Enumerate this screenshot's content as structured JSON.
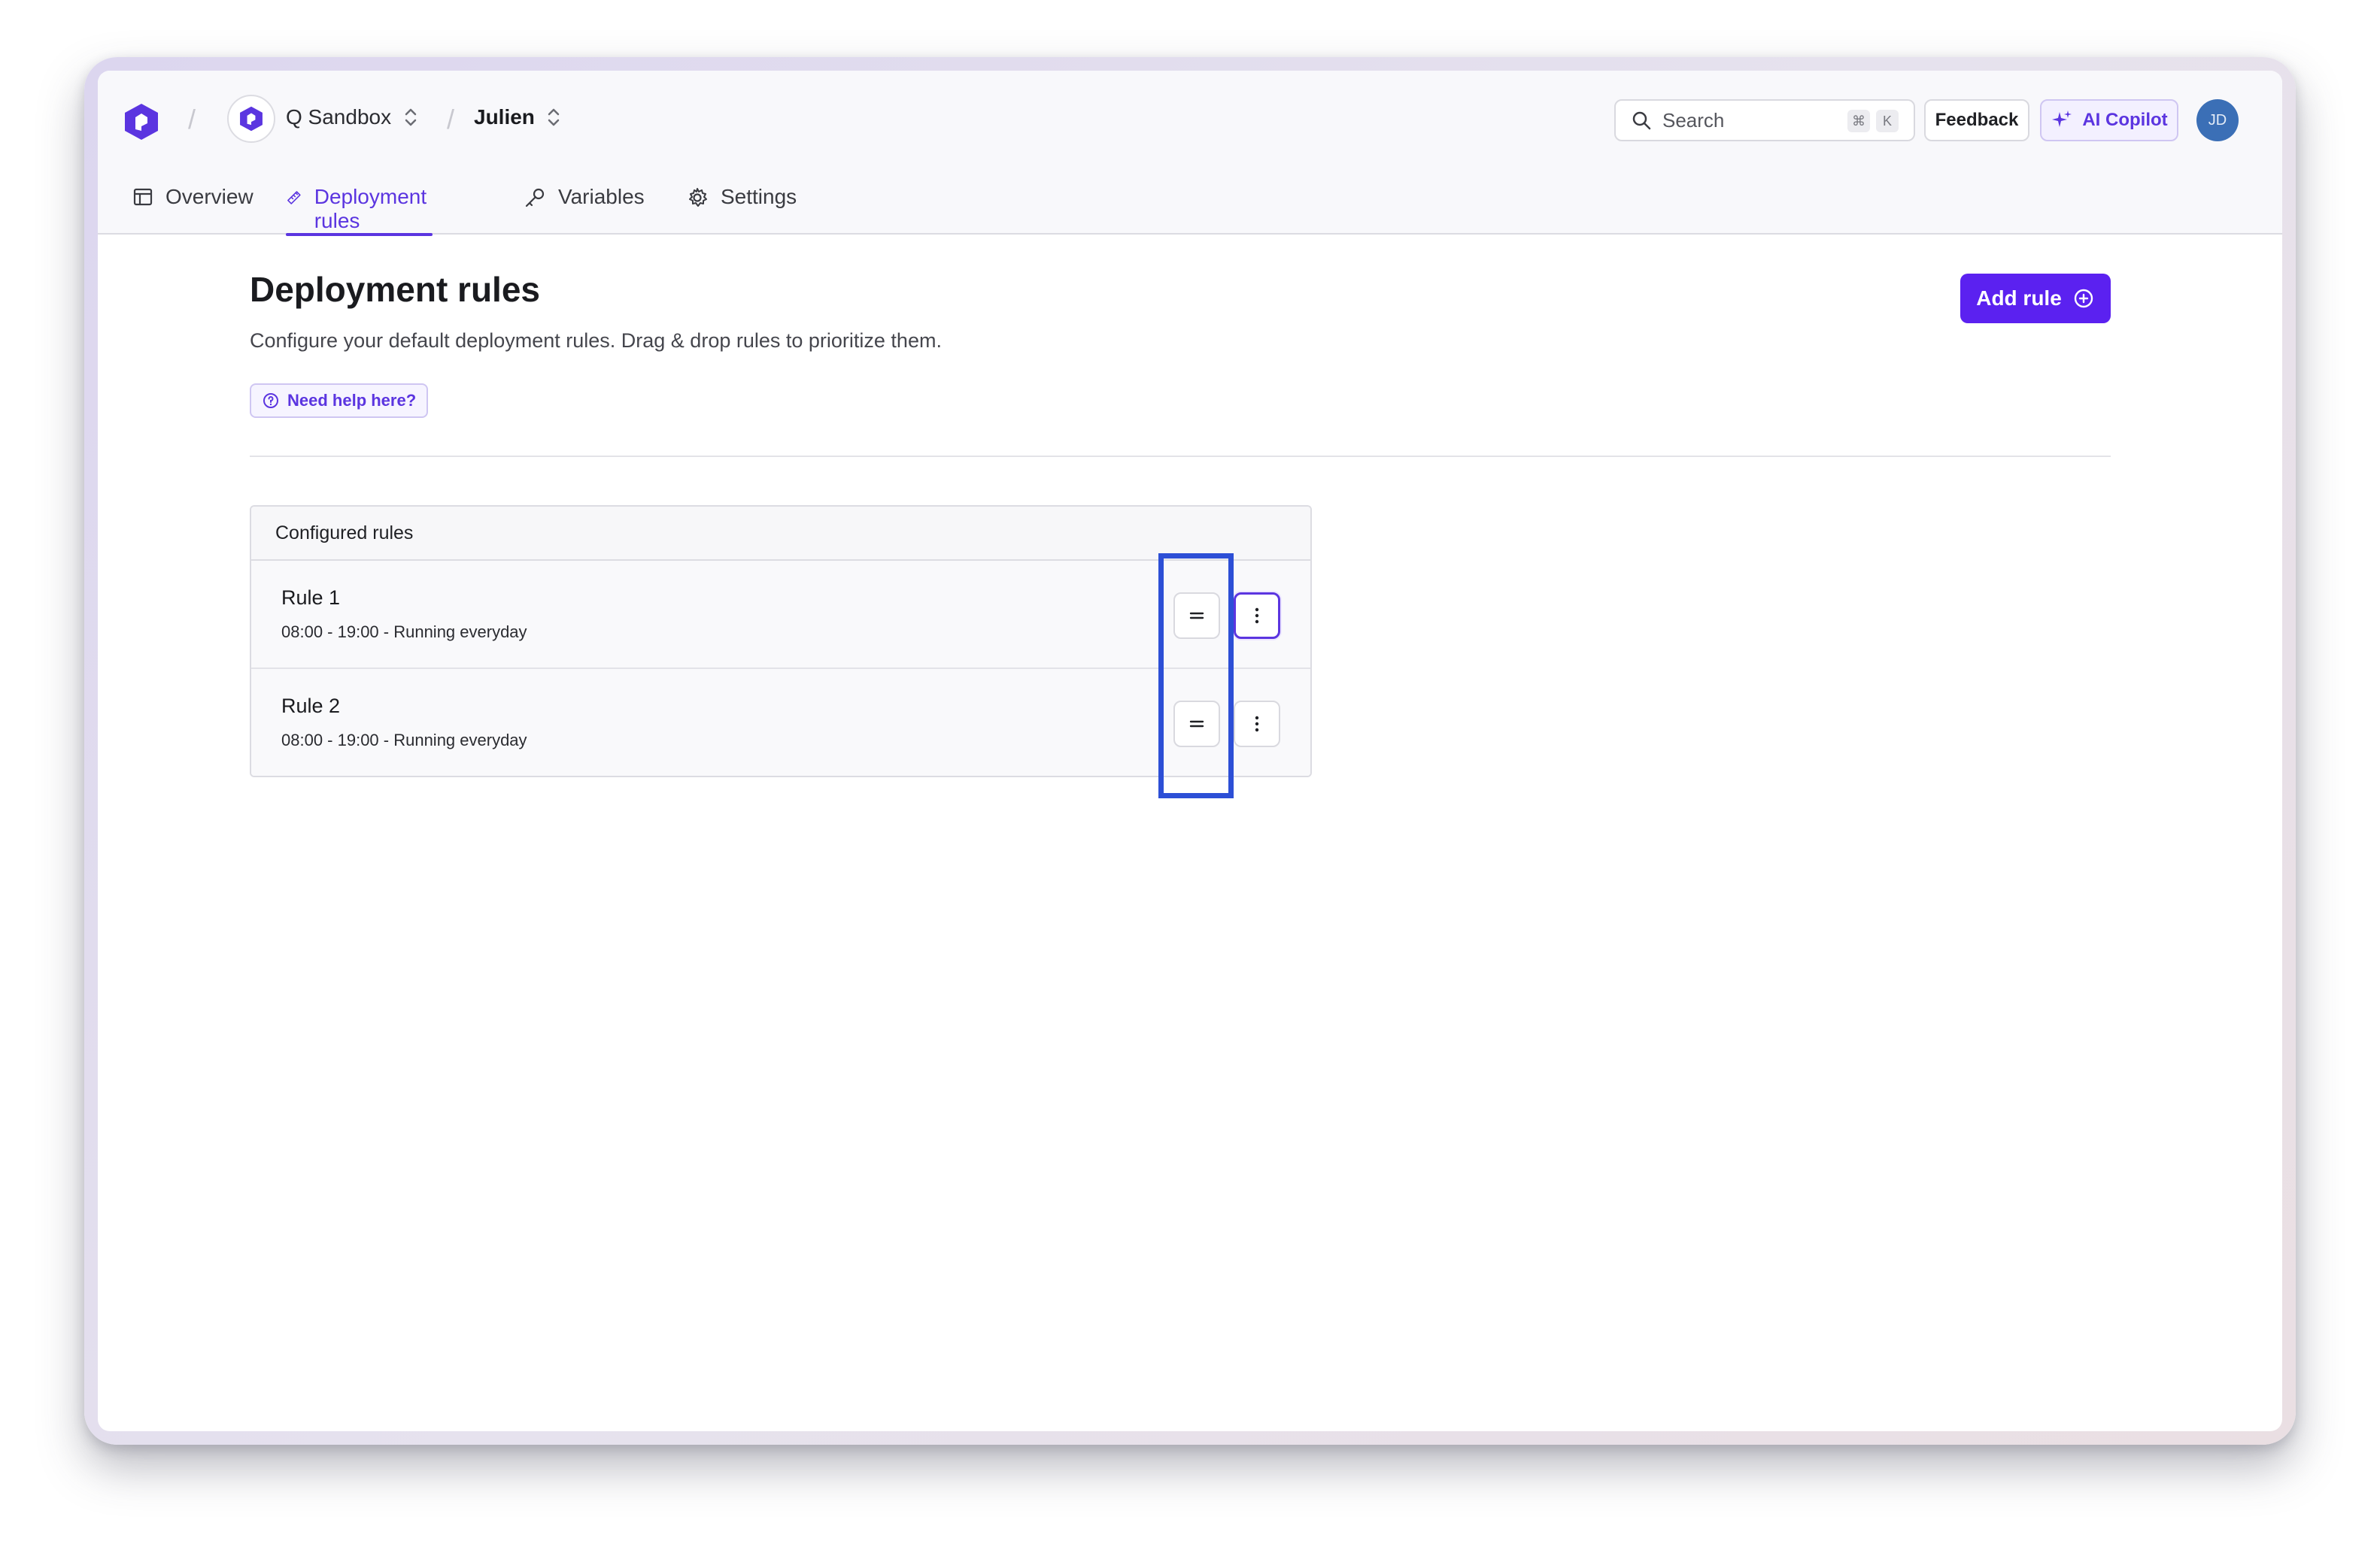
{
  "header": {
    "org_name": "Q Sandbox",
    "project_name": "Julien",
    "search_placeholder": "Search",
    "search_shortcut_mod": "⌘",
    "search_shortcut_key": "K",
    "feedback_label": "Feedback",
    "copilot_label": "AI Copilot",
    "user_initials": "JD"
  },
  "tabs": [
    {
      "label": "Overview",
      "icon": "layout-icon",
      "active": false
    },
    {
      "label": "Deployment rules",
      "icon": "ruler-icon",
      "active": true
    },
    {
      "label": "Variables",
      "icon": "key-icon",
      "active": false
    },
    {
      "label": "Settings",
      "icon": "gear-icon",
      "active": false
    }
  ],
  "page": {
    "title": "Deployment rules",
    "subtitle": "Configure your default deployment rules. Drag & drop rules to prioritize them.",
    "help_label": "Need help here?",
    "add_rule_label": "Add rule"
  },
  "rules": {
    "header": "Configured rules",
    "items": [
      {
        "name": "Rule 1",
        "schedule": "08:00 - 19:00 - Running everyday"
      },
      {
        "name": "Rule 2",
        "schedule": "08:00 - 19:00 - Running everyday"
      }
    ]
  },
  "colors": {
    "accent": "#5b35e0",
    "primary_button": "#5b21f0",
    "highlight_box": "#2d4fd6",
    "avatar": "#3b6fb6"
  }
}
